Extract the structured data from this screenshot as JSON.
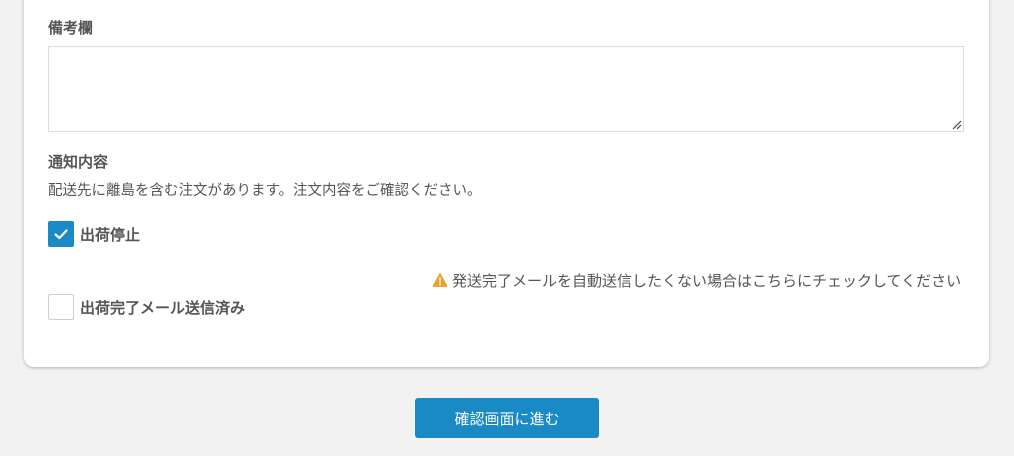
{
  "remarks": {
    "label": "備考欄",
    "value": ""
  },
  "notice": {
    "label": "通知内容",
    "text": "配送先に離島を含む注文があります。注文内容をご確認ください。"
  },
  "options": [
    {
      "label": "出荷停止",
      "checked": true
    },
    {
      "label": "出荷完了メール送信済み",
      "checked": false
    }
  ],
  "warning": {
    "icon": "warning-icon",
    "text": "発送完了メールを自動送信したくない場合はこちらにチェックしてください",
    "color": "#f0a030"
  },
  "confirm_button": {
    "label": "確認画面に進む",
    "color": "#1a8ac6"
  }
}
